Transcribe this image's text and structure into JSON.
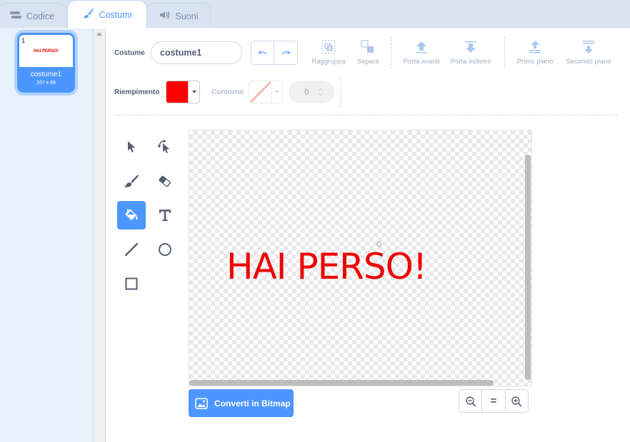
{
  "tabs": [
    {
      "label": "Codice",
      "icon": "code-icon"
    },
    {
      "label": "Costumi",
      "icon": "brush-icon"
    },
    {
      "label": "Suoni",
      "icon": "speaker-icon"
    }
  ],
  "costumes": [
    {
      "number": "1",
      "name": "costume1",
      "size": "267 x 69",
      "thumb_text": "HAI PERSO!"
    }
  ],
  "toolbar": {
    "costume_label": "Costume",
    "costume_name": "costume1",
    "group": "Raggruppa",
    "ungroup": "Separa",
    "forward": "Porta avanti",
    "backward": "Porta indietro",
    "front": "Primo piano",
    "back": "Secondo piano",
    "fill_label": "Riempimento",
    "fill_color": "#ff0000",
    "outline_label": "Contorno",
    "outline_width": "0"
  },
  "tools": [
    "select-tool",
    "reshape-tool",
    "brush-tool",
    "eraser-tool",
    "fill-tool",
    "text-tool",
    "line-tool",
    "circle-tool",
    "rectangle-tool"
  ],
  "selected_tool": "fill-tool",
  "canvas": {
    "text": "HAI PERSO!",
    "text_color": "#ee0000"
  },
  "bitmap_button": "Converti in Bitmap",
  "colors": {
    "accent": "#4c97ff",
    "panel_bg": "#e9f1fc"
  }
}
